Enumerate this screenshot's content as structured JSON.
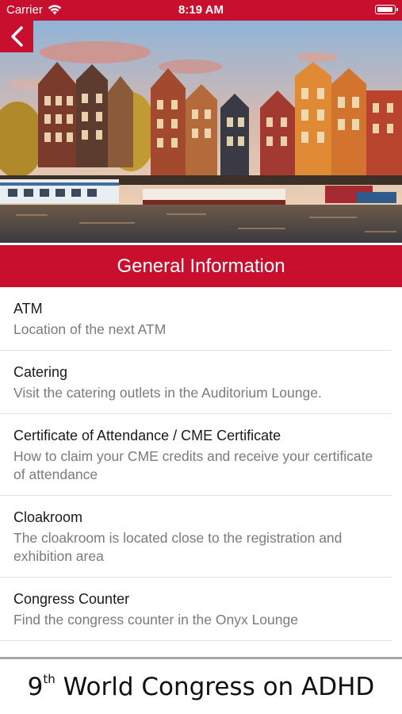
{
  "status_bar": {
    "carrier": "Carrier",
    "time": "8:19 AM",
    "wifi_icon": "wifi-icon",
    "battery_icon": "battery-icon"
  },
  "navigation": {
    "back_icon": "chevron-left-icon"
  },
  "hero_image": {
    "subject": "amsterdam-canal-houses"
  },
  "section_header": {
    "title": "General Information"
  },
  "items": [
    {
      "title": "ATM",
      "description": "Location of the next ATM"
    },
    {
      "title": "Catering",
      "description": "Visit the catering outlets in the Auditorium Lounge."
    },
    {
      "title": "Certificate of Attendance / CME Certificate",
      "description": "How to claim your CME credits and receive your certificate of attendance"
    },
    {
      "title": "Cloakroom",
      "description": "The cloakroom is located close to the registration and exhibition area"
    },
    {
      "title": "Congress Counter",
      "description": "Find the congress counter in the Onyx Lounge"
    }
  ],
  "footer": {
    "ordinal_number": "9",
    "ordinal_suffix": "th",
    "title": "World Congress on ADHD"
  },
  "colors": {
    "brand_red": "#c8102e",
    "text_primary": "#1a1a1a",
    "text_secondary": "#7a7a7a",
    "divider": "#e2e2e2"
  }
}
